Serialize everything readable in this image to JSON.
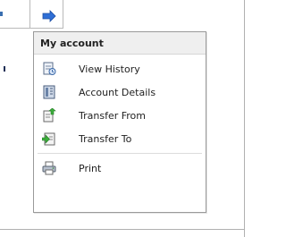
{
  "menu": {
    "title": "My account",
    "items": [
      {
        "label": "View History",
        "icon": "history-icon"
      },
      {
        "label": "Account Details",
        "icon": "details-icon"
      },
      {
        "label": "Transfer From",
        "icon": "transfer-from-icon"
      },
      {
        "label": "Transfer To",
        "icon": "transfer-to-icon"
      }
    ],
    "print": {
      "label": "Print",
      "icon": "printer-icon"
    }
  },
  "colors": {
    "arrow": "#1f5fc4",
    "menu_border": "#9a9a9a",
    "header_bg": "#efefef"
  }
}
